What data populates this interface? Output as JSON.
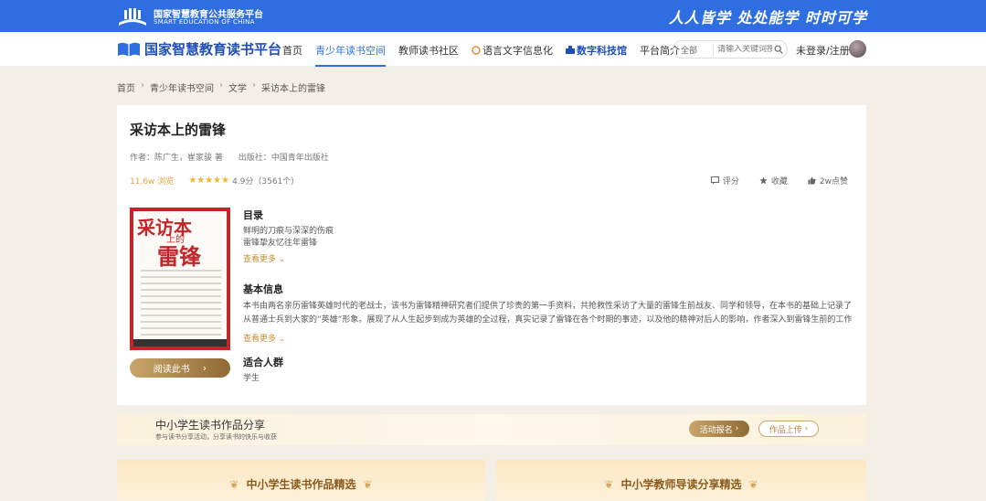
{
  "topbar": {
    "org_cn": "国家智慧教育公共服务平台",
    "org_en": "SMART EDUCATION OF CHINA",
    "slogan": "人人皆学 处处能学 时时可学"
  },
  "nav": {
    "brand": "国家智慧教育读书平台",
    "items": [
      {
        "label": "首页"
      },
      {
        "label": "青少年读书空间"
      },
      {
        "label": "教师读书社区"
      },
      {
        "label": "语言文字信息化"
      },
      {
        "label": "数字科技馆"
      },
      {
        "label": "平台简介"
      }
    ],
    "search_type": "全部",
    "search_placeholder": "请输入关键词搜索",
    "login": "未登录/注册"
  },
  "breadcrumb": [
    "首页",
    "青少年读书空间",
    "文学",
    "采访本上的雷锋"
  ],
  "book": {
    "title": "采访本上的雷锋",
    "author": "作者：陈广生，崔家骏 著",
    "publisher": "出版社：中国青年出版社",
    "views": "11.6w 浏览",
    "stars": "★★★★★",
    "score": "4.9分（3561个）",
    "actions": {
      "rate": "评分",
      "collect": "收藏",
      "like": "2w点赞"
    },
    "cover": {
      "t1": "采访本",
      "t2": "上的",
      "t3": "雷锋"
    },
    "read_btn": "阅读此书",
    "toc_title": "目录",
    "toc_lines": [
      "鲜明的刀痕与深深的伤痕",
      "雷锋挚友忆往年雷锋"
    ],
    "toc_more": "查看更多",
    "info_title": "基本信息",
    "intro": "本书由两名亲历雷锋英雄时代的老战士，该书为雷锋精神研究者们提供了珍贵的第一手资料，共抢救性采访了大量的雷锋生前战友、同学和领导，在本书的基础上记录了从普通士兵到大家的“英雄”形象。展现了从人生起步到成为英雄的全过程，真实记录了雷锋在各个时期的事迹，以及他的精神对后人的影响，作者深入到雷锋生前的工作地区进行采访，包括部队、学校、工厂等多个地方。",
    "info_more": "查看更多",
    "audience_title": "适合人群",
    "audience": "学生"
  },
  "share": {
    "title": "中小学生读书作品分享",
    "sub": "参与读书分享活动，分享读书的快乐与收获",
    "signup": "活动报名",
    "upload": "作品上传"
  },
  "panels": {
    "left": "中小学生读书作品精选",
    "right": "中小学教师导读分享精选"
  }
}
